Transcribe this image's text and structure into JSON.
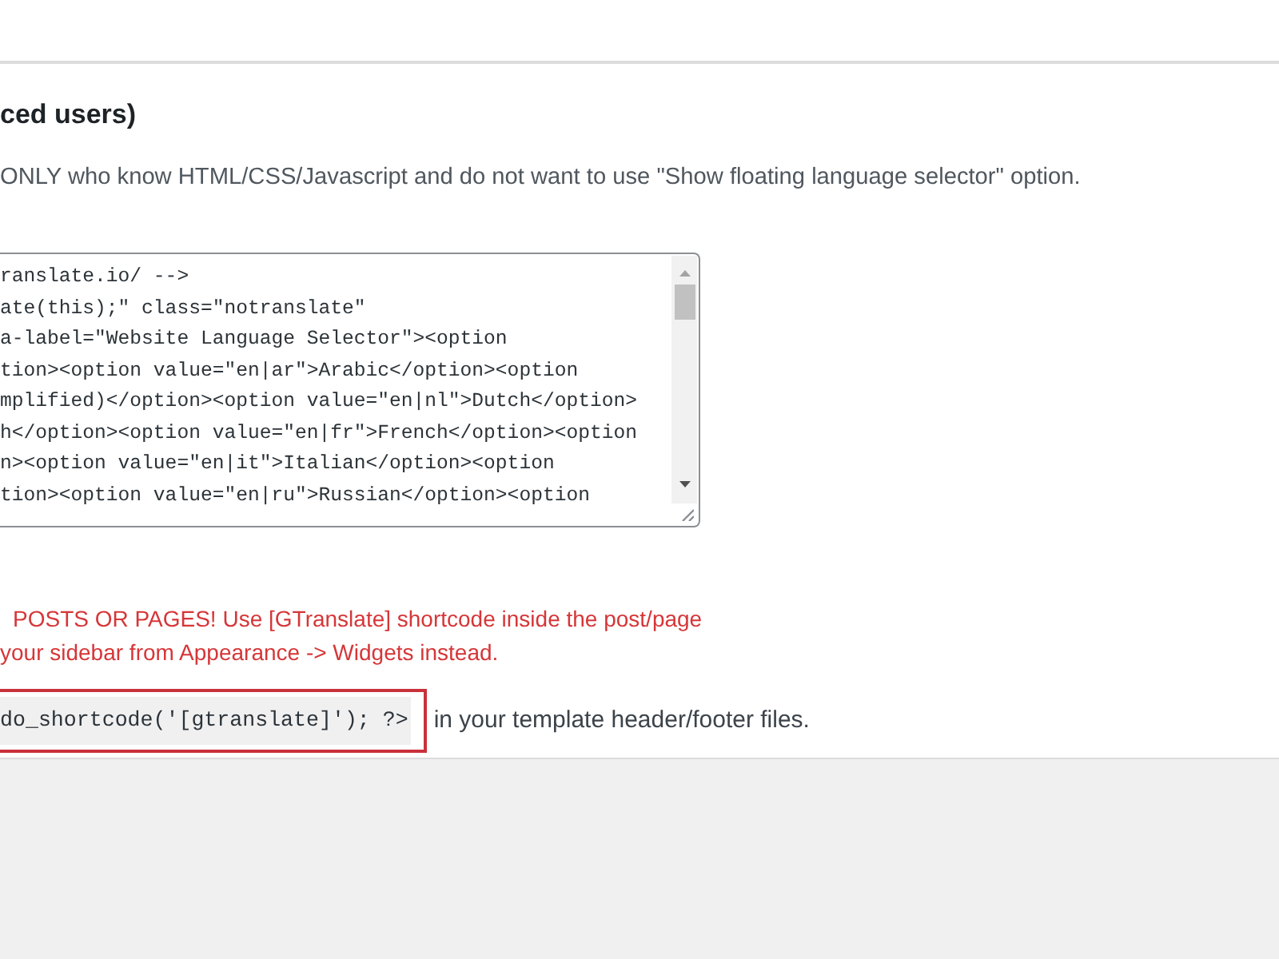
{
  "section": {
    "heading": "ced users)",
    "description": "ONLY who know HTML/CSS/Javascript and do not want to use \"Show floating language selector\" option."
  },
  "code_field": {
    "lines": [
      "ranslate.io/ -->",
      "ate(this);\" class=\"notranslate\"",
      "a-label=\"Website Language Selector\"><option",
      "tion><option value=\"en|ar\">Arabic</option><option",
      "mplified)</option><option value=\"en|nl\">Dutch</option>",
      "h</option><option value=\"en|fr\">French</option><option",
      "n><option value=\"en|it\">Italian</option><option",
      "tion><option value=\"en|ru\">Russian</option><option"
    ]
  },
  "warning": {
    "lines": [
      "POSTS OR PAGES! Use [GTranslate] shortcode inside the post/page",
      "your sidebar from Appearance -> Widgets instead."
    ]
  },
  "shortcode_row": {
    "code": "do_shortcode('[gtranslate]'); ?>",
    "highlighted": true,
    "text": "in your template header/footer files."
  }
}
